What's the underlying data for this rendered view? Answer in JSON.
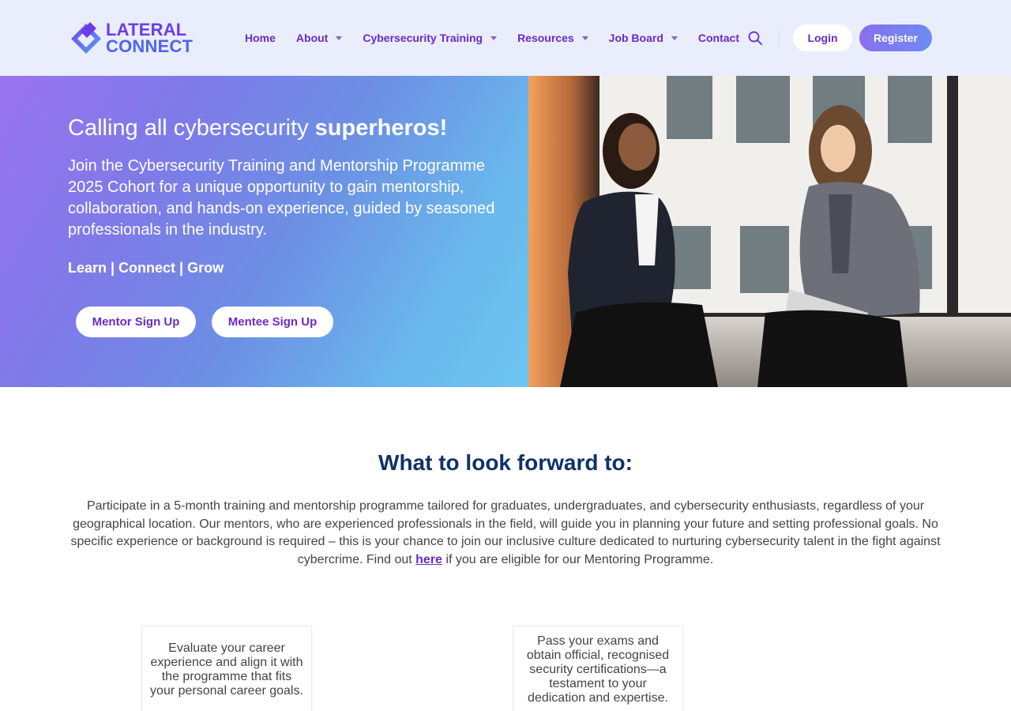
{
  "brand": {
    "line1": "LATERAL",
    "line2": "CONNECT",
    "accent": "#6a2bc4",
    "secondary": "#4f63f0"
  },
  "nav": {
    "items": [
      {
        "label": "Home",
        "has_dropdown": false
      },
      {
        "label": "About",
        "has_dropdown": true
      },
      {
        "label": "Cybersecurity Training",
        "has_dropdown": true
      },
      {
        "label": "Resources",
        "has_dropdown": true
      },
      {
        "label": "Job Board",
        "has_dropdown": true
      },
      {
        "label": "Contact",
        "has_dropdown": false
      }
    ],
    "search_icon": "search-icon",
    "login_label": "Login",
    "register_label": "Register"
  },
  "hero": {
    "title_prefix": "Calling all cybersecurity ",
    "title_emphasis": "superheros!",
    "description": "Join the Cybersecurity Training and Mentorship Programme 2025 Cohort for a unique opportunity to gain mentorship, collaboration, and hands-on experience, guided by seasoned professionals in the industry.",
    "tagline": "Learn | Connect | Grow",
    "mentor_button": "Mentor Sign Up",
    "mentee_button": "Mentee Sign Up",
    "gradient_start": "#9a74f0",
    "gradient_end": "#6cc6f0"
  },
  "section": {
    "title": "What to look forward to:",
    "body_before_link": "Participate in a 5-month training and mentorship programme tailored for graduates, undergraduates, and cybersecurity enthusiasts, regardless of your geographical location. Our mentors, who are experienced professionals in the field, will guide you in planning your future and setting professional goals. No specific experience or background is required – this is your chance to join our inclusive culture dedicated to nurturing cybersecurity talent in the fight against cybercrime. Find out ",
    "link_text": "here",
    "body_after_link": " if you are eligible for our Mentoring Programme.",
    "title_color": "#0f3266"
  },
  "cards": [
    {
      "text": "Evaluate your career experience and align it with the programme that fits your personal career goals."
    },
    {
      "text": "Pass your exams and obtain official, recognised security certifications—a testament to your dedication and expertise."
    }
  ]
}
